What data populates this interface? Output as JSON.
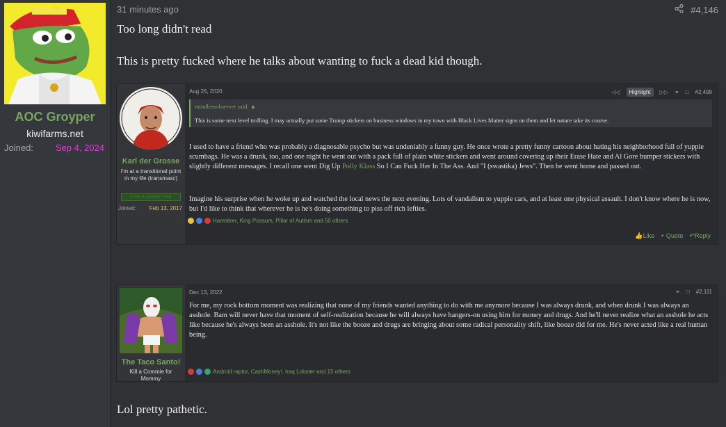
{
  "author": {
    "name": "AOC Groyper",
    "title": "kiwifarms.net",
    "joined_label": "Joined:",
    "joined_date": "Sep 4, 2024"
  },
  "post": {
    "time": "31 minutes ago",
    "number": "#4,146",
    "line1": "Too long didn't read",
    "line2": "This is pretty fucked where he talks about wanting to fuck a dead kid though.",
    "closing": "Lol pretty pathetic."
  },
  "quote1": {
    "user_name": "Karl der Grosse",
    "user_title": "I'm at a transitional point in my life (transmasc)",
    "user_badge": "True & Honest Fan",
    "joined_label": "Joined:",
    "joined_date": "Feb 13, 2017",
    "date": "Aug 26, 2020",
    "highlight": "Highlight",
    "number": "#2,499",
    "quoted_author": "mindlessobserver said:",
    "quoted_text": "This is some next level trolling. I may actually put some Trump stickers on business windows in my town with Black Lives Matter signs on them and let nature take its course.",
    "para1_a": "I used to have a friend who was probably a diagnosable psycho but was undeniably a funny guy. He once wrote a pretty funny cartoon about hating his neighborhood full of yuppie scumbags. He was a drunk, too, and one night he went out with a pack full of plain white stickers and went around covering up their Erase Hate and Al Gore bumper stickers with slightly different messages. I recall one went Dig Up ",
    "para1_link": "Polly Klass",
    "para1_b": " So I Can Fuck Her In The Ass. And \"I (swastika) Jews\". Then he went home and passed out.",
    "para2": "Imagine his surprise when he woke up and watched the local news the next evening. Lots of vandalism to yuppie cars, and at least one physical assault. I don't know where he is now, but I'd like to think that wherever he is he's doing something to piss off rich lefties.",
    "reactions": "Hamstirer, King Possum, Pillar of Autism and 50 others",
    "like": "Like",
    "quote": "+ Quote",
    "reply": "Reply"
  },
  "quote2": {
    "user_name": "The Taco Santo!",
    "user_title": "Kill a Commie for Mommy",
    "date": "Dec 13, 2022",
    "number": "#2,111",
    "text": "For me, my rock bottom moment was realizing that none of my friends wanted anything to do with me anymore because I was always drunk, and when drunk I was always an asshole. Bam will never have that moment of self-realization because he will always have hangers-on using him for money and drugs. And he'll never realize what an asshole he acts like because he's always been an asshole. It's not like the booze and drugs are bringing about some radical personality shift, like booze did for me. He's never acted like a real human being.",
    "reactions": "Android raptor, CashMoney!, Iraq Lobster and 15 others"
  },
  "colors": {
    "accent": "#7aa55f",
    "joined_date_outer": "#e43bd8",
    "background": "#2f3135"
  }
}
